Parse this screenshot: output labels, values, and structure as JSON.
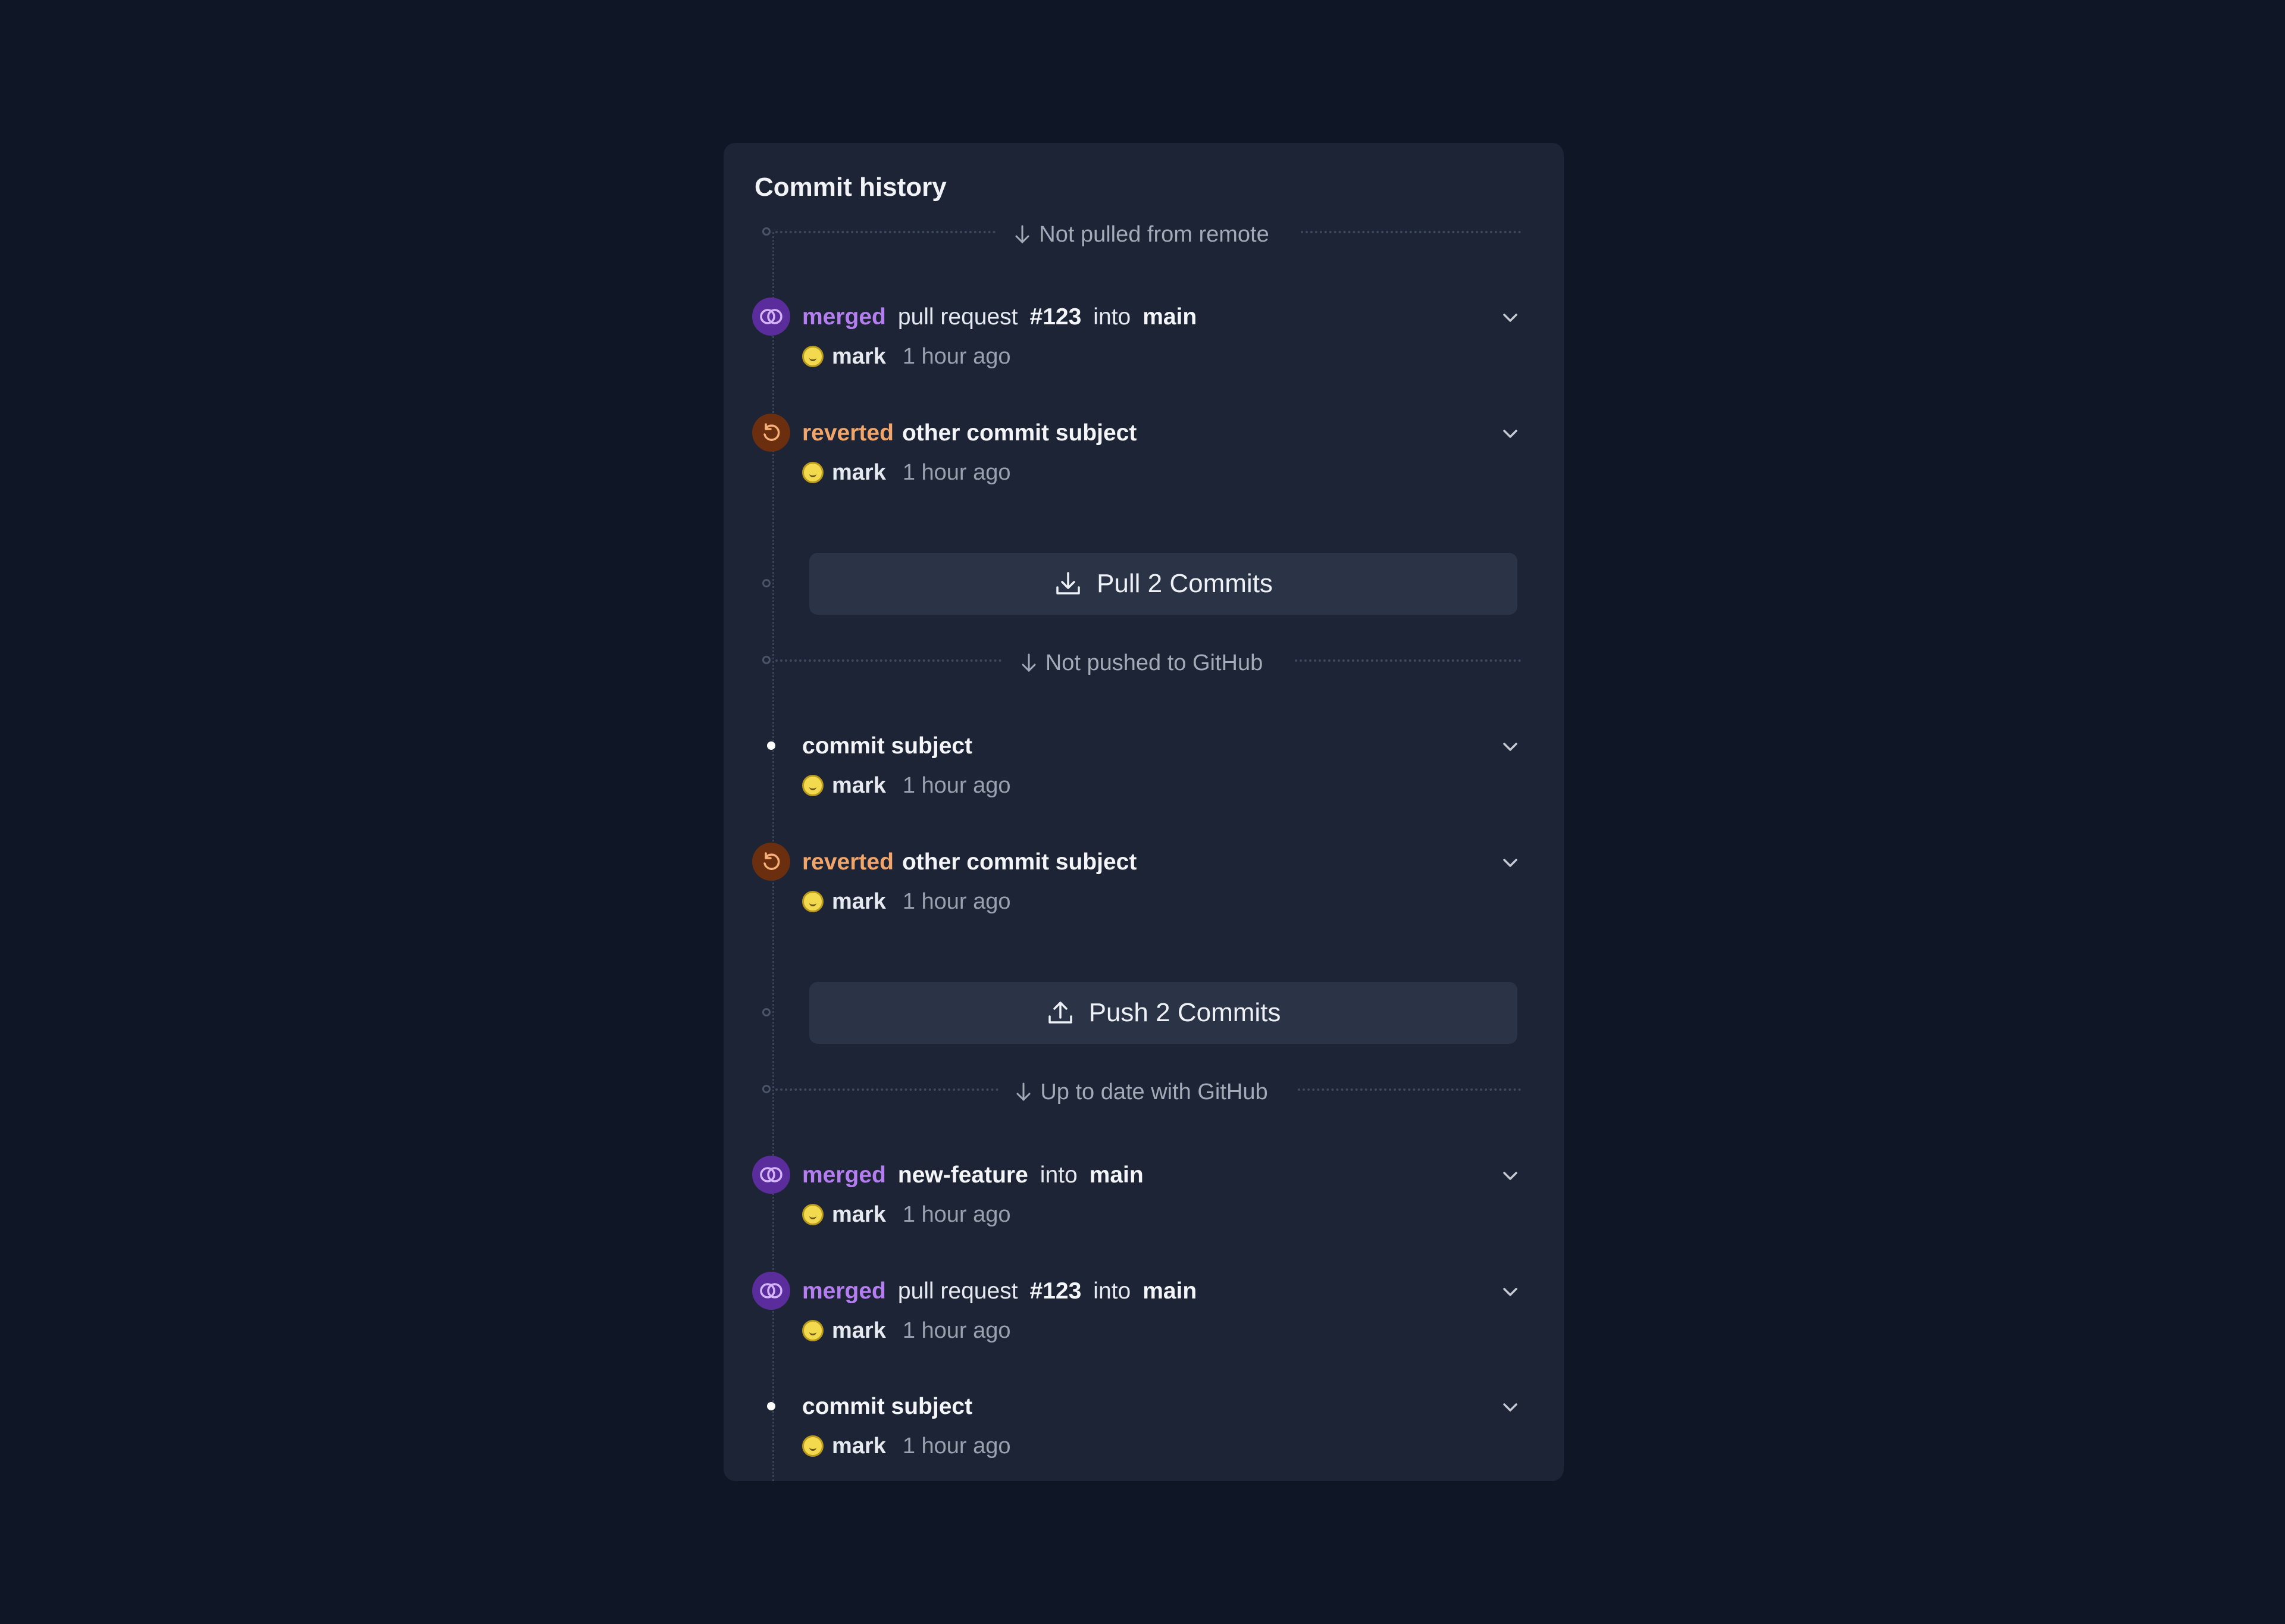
{
  "panel": {
    "title": "Commit history"
  },
  "dividers": [
    {
      "label": "Not pulled from remote"
    },
    {
      "label": "Not pushed to GitHub"
    },
    {
      "label": "Up to date with GitHub"
    }
  ],
  "commits": [
    {
      "type": "merged",
      "keyword": "merged",
      "parts": [
        "pull request",
        "#123",
        "into",
        "main"
      ],
      "author": "mark",
      "time": "1 hour ago"
    },
    {
      "type": "reverted",
      "keyword": "reverted",
      "parts": [
        "other commit subject"
      ],
      "author": "mark",
      "time": "1 hour ago"
    },
    {
      "type": "plain",
      "parts": [
        "commit subject"
      ],
      "author": "mark",
      "time": "1 hour ago"
    },
    {
      "type": "reverted",
      "keyword": "reverted",
      "parts": [
        "other commit subject"
      ],
      "author": "mark",
      "time": "1 hour ago"
    },
    {
      "type": "merged",
      "keyword": "merged",
      "parts": [
        "new-feature",
        "into",
        "main"
      ],
      "author": "mark",
      "time": "1 hour ago"
    },
    {
      "type": "merged",
      "keyword": "merged",
      "parts": [
        "pull request",
        "#123",
        "into",
        "main"
      ],
      "author": "mark",
      "time": "1 hour ago"
    },
    {
      "type": "plain",
      "parts": [
        "commit subject"
      ],
      "author": "mark",
      "time": "1 hour ago"
    }
  ],
  "actions": {
    "pull_label": "Pull 2 Commits",
    "push_label": "Push 2 Commits"
  },
  "colors": {
    "background": "#0f1626",
    "panel": "#1d2435",
    "merged_accent": "#b57ef0",
    "reverted_accent": "#f0a56a",
    "button": "#2b3347"
  },
  "icons": {
    "merged": "merge-rings-icon",
    "reverted": "revert-icon",
    "pull": "download-icon",
    "push": "upload-icon",
    "expand": "chevron-down-icon",
    "divider": "arrow-down-icon"
  }
}
